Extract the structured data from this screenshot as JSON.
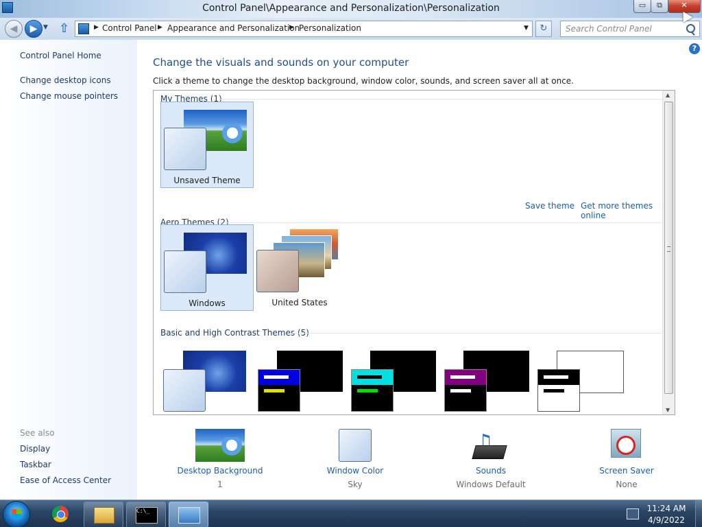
{
  "window": {
    "title": "Control Panel\\Appearance and Personalization\\Personalization",
    "min_label": "▭",
    "max_label": "⧉",
    "close_label": "✕"
  },
  "address": {
    "crumbs": [
      "Control Panel",
      "Appearance and Personalization",
      "Personalization"
    ],
    "search_placeholder": "Search Control Panel"
  },
  "sidebar": {
    "links": [
      "Control Panel Home",
      "Change desktop icons",
      "Change mouse pointers"
    ],
    "see_also_label": "See also",
    "see_also": [
      "Display",
      "Taskbar",
      "Ease of Access Center"
    ]
  },
  "main": {
    "heading": "Change the visuals and sounds on your computer",
    "subtext": "Click a theme to change the desktop background, window color, sounds, and screen saver all at once.",
    "groups": {
      "my_themes": "My Themes (1)",
      "aero_themes": "Aero Themes (2)",
      "basic_themes": "Basic and High Contrast Themes (5)"
    },
    "themes": {
      "unsaved": "Unsaved Theme",
      "windows": "Windows",
      "united_states": "United States"
    },
    "save_theme": "Save theme",
    "get_more": "Get more themes online"
  },
  "settings": [
    {
      "label": "Desktop Background",
      "value": "1"
    },
    {
      "label": "Window Color",
      "value": "Sky"
    },
    {
      "label": "Sounds",
      "value": "Windows Default"
    },
    {
      "label": "Screen Saver",
      "value": "None"
    }
  ],
  "taskbar": {
    "time": "11:24 AM",
    "date": "4/9/2022",
    "cmd_text": "C:\\_"
  },
  "colors": {
    "link": "#1d5ea8",
    "heading": "#1d4f91",
    "selected_tile": "#dbe9f8"
  }
}
